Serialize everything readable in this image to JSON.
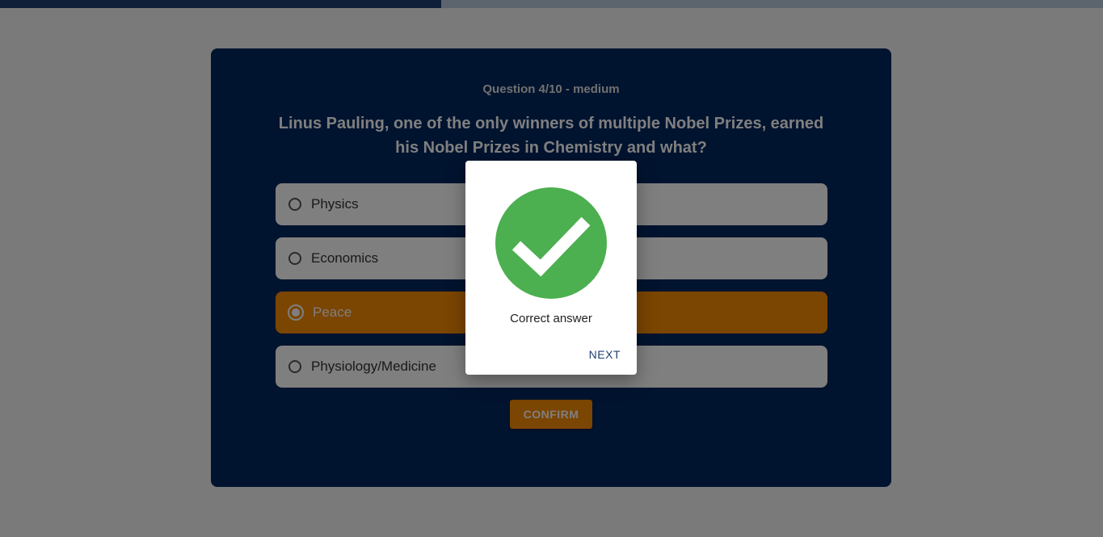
{
  "progress": {
    "fraction": 0.4,
    "fill_color": "#1f3f73",
    "track_color": "#b8c8dc"
  },
  "quiz": {
    "meta": "Question 4/10 - medium",
    "question": "Linus Pauling, one of the only winners of multiple Nobel Prizes, earned his Nobel Prizes in Chemistry and what?",
    "options": [
      {
        "label": "Physics",
        "selected": false
      },
      {
        "label": "Economics",
        "selected": false
      },
      {
        "label": "Peace",
        "selected": true
      },
      {
        "label": "Physiology/Medicine",
        "selected": false
      }
    ],
    "confirm_label": "CONFIRM",
    "card_color": "#00275e",
    "accent_color": "#f78a04"
  },
  "dialog": {
    "icon": "check-circle-icon",
    "icon_color": "#4caf50",
    "message": "Correct answer",
    "next_label": "NEXT"
  }
}
